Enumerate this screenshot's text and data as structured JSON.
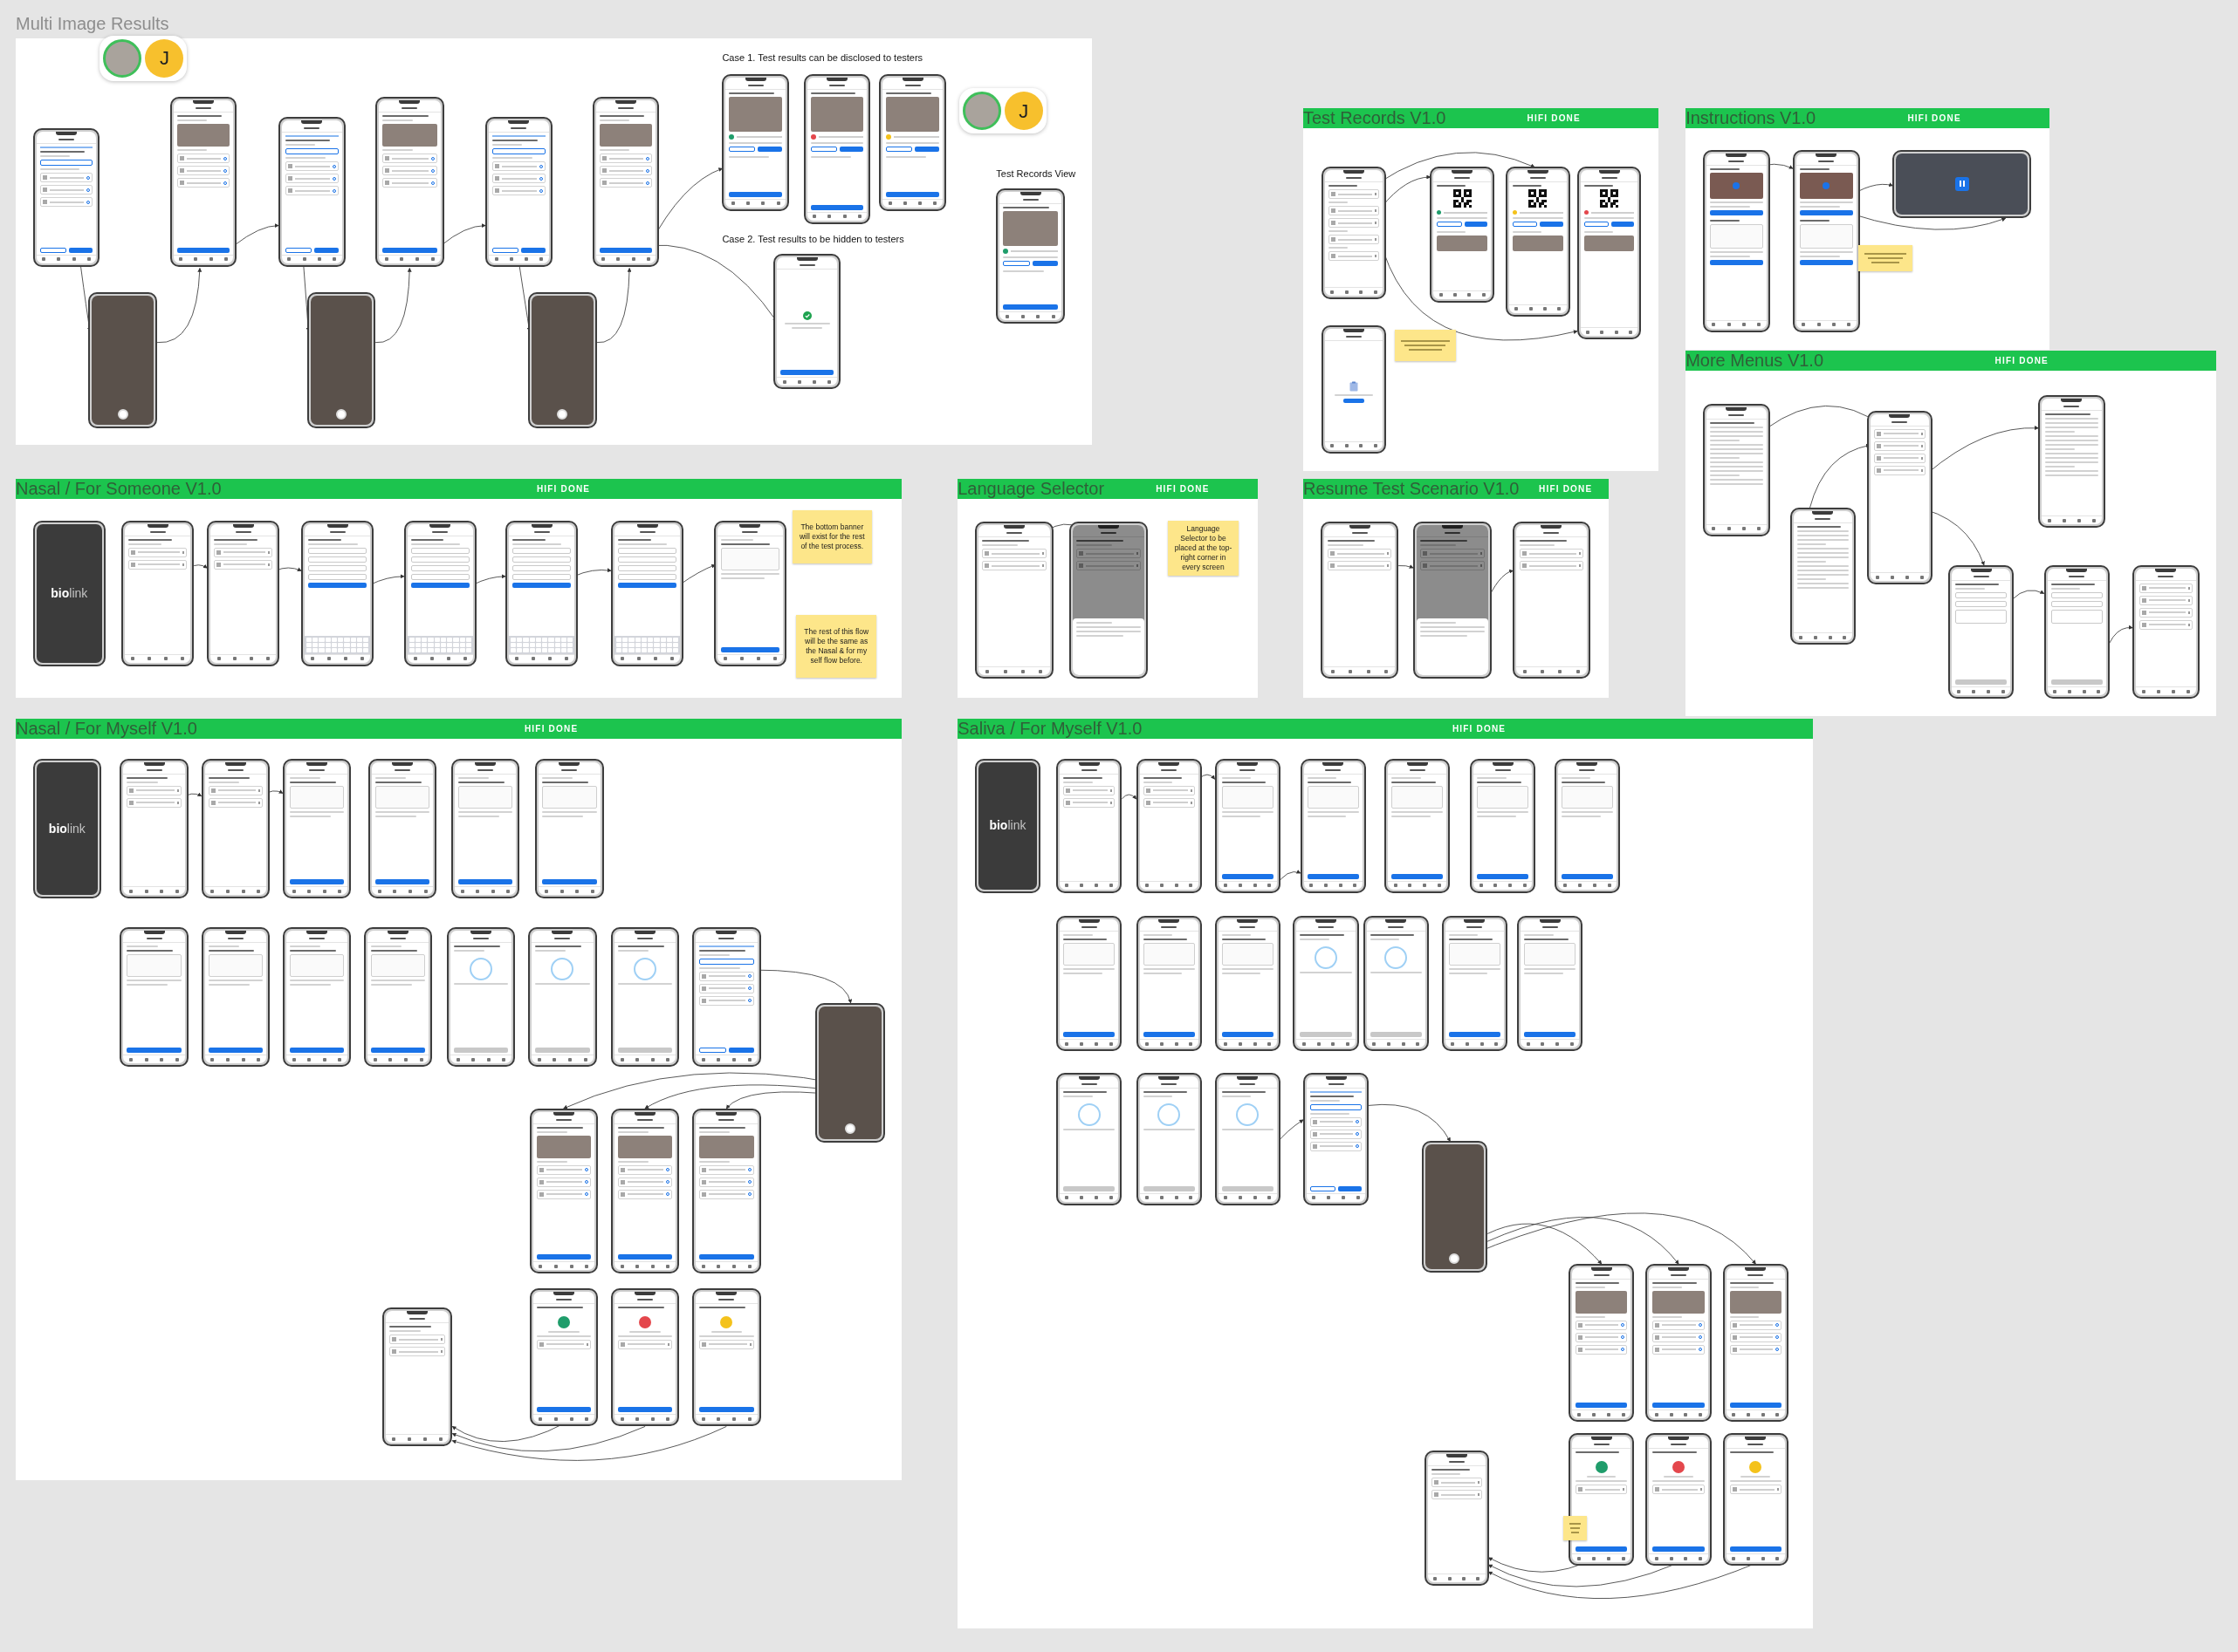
{
  "canvas": {
    "frames": [
      {
        "title": "Multi Image Results",
        "avatar_groups": [
          {
            "initial": "J"
          },
          {
            "initial": "J"
          }
        ],
        "captions": [
          {
            "text": "Case 1. Test results can be disclosed to testers"
          },
          {
            "text": "Case 2. Test results to be hidden to testers"
          },
          {
            "text": "Test Records View"
          }
        ],
        "screens": [
          {
            "kind": "choice"
          },
          {
            "kind": "photo"
          },
          {
            "kind": "choice"
          },
          {
            "kind": "photo"
          },
          {
            "kind": "choice"
          },
          {
            "kind": "photo"
          },
          {
            "kind": "camera"
          },
          {
            "kind": "camera"
          },
          {
            "kind": "camera"
          },
          {
            "kind": "record",
            "color": "#1f9d6b"
          },
          {
            "kind": "record",
            "color": "#e4474c"
          },
          {
            "kind": "record",
            "color": "#f4c21b"
          },
          {
            "kind": "done"
          },
          {
            "kind": "record",
            "color": "#1f9d6b"
          }
        ]
      },
      {
        "title": "Test Records V1.0",
        "badge": "HIFI DONE",
        "screens": [
          {
            "kind": "records"
          },
          {
            "kind": "qr",
            "color": "#1f9d6b"
          },
          {
            "kind": "qr",
            "color": "#f4c21b"
          },
          {
            "kind": "qr",
            "color": "#e4474c"
          },
          {
            "kind": "empty"
          }
        ],
        "notes": [
          {
            "kind": "scribble"
          }
        ]
      },
      {
        "title": "Instructions V1.0",
        "badge": "HIFI DONE",
        "screens": [
          {
            "kind": "instructions"
          },
          {
            "kind": "instructions"
          },
          {
            "kind": "video"
          }
        ],
        "notes": [
          {
            "kind": "scribble"
          }
        ]
      },
      {
        "title": "More Menus V1.0",
        "badge": "HIFI DONE",
        "screens": [
          {
            "kind": "text"
          },
          {
            "kind": "text"
          },
          {
            "kind": "menu"
          },
          {
            "kind": "text"
          },
          {
            "kind": "form"
          },
          {
            "kind": "form"
          },
          {
            "kind": "menu"
          }
        ]
      },
      {
        "title": "Nasal / For Someone V1.0",
        "badge": "HIFI DONE",
        "screens": [
          {
            "kind": "splash",
            "logo": "**bio**link"
          },
          {
            "kind": "list"
          },
          {
            "kind": "list"
          },
          {
            "kind": "keyboard"
          },
          {
            "kind": "keyboard"
          },
          {
            "kind": "keyboard"
          },
          {
            "kind": "keyboard"
          },
          {
            "kind": "app"
          }
        ],
        "notes": [
          {
            "kind": "text",
            "text": "The bottom banner will exist for the rest of the test process."
          },
          {
            "kind": "text",
            "text": "The rest of this flow will be the same as the Nasal & for my self flow before."
          }
        ]
      },
      {
        "title": "Language Selector",
        "badge": "HIFI DONE",
        "screens": [
          {
            "kind": "list"
          },
          {
            "kind": "overlay"
          }
        ],
        "notes": [
          {
            "kind": "text",
            "text": "Language Selector to be placed at the top-right corner in every screen"
          }
        ]
      },
      {
        "title": "Resume Test Scenario V1.0",
        "badge": "HIFI DONE",
        "screens": [
          {
            "kind": "list"
          },
          {
            "kind": "overlay"
          },
          {
            "kind": "list"
          }
        ]
      },
      {
        "title": "Nasal / For Myself V1.0",
        "badge": "HIFI DONE",
        "screens": [
          {
            "kind": "splash",
            "logo": "**bio**link"
          },
          {
            "kind": "list"
          },
          {
            "kind": "list"
          },
          {
            "kind": "app"
          },
          {
            "kind": "app"
          },
          {
            "kind": "app"
          },
          {
            "kind": "app"
          },
          {
            "kind": "app"
          },
          {
            "kind": "app"
          },
          {
            "kind": "app"
          },
          {
            "kind": "app"
          },
          {
            "kind": "timer"
          },
          {
            "kind": "timer"
          },
          {
            "kind": "timer"
          },
          {
            "kind": "choice"
          },
          {
            "kind": "camera"
          },
          {
            "kind": "photo"
          },
          {
            "kind": "photo"
          },
          {
            "kind": "photo"
          },
          {
            "kind": "result",
            "color": "#1f9d6b"
          },
          {
            "kind": "result",
            "color": "#e4474c"
          },
          {
            "kind": "result",
            "color": "#f4c21b"
          },
          {
            "kind": "list"
          }
        ]
      },
      {
        "title": "Saliva / For Myself V1.0",
        "badge": "HIFI DONE",
        "screens": [
          {
            "kind": "splash",
            "logo": "**bio**link"
          },
          {
            "kind": "list"
          },
          {
            "kind": "list"
          },
          {
            "kind": "app"
          },
          {
            "kind": "app"
          },
          {
            "kind": "app"
          },
          {
            "kind": "app"
          },
          {
            "kind": "app"
          },
          {
            "kind": "app"
          },
          {
            "kind": "app"
          },
          {
            "kind": "app"
          },
          {
            "kind": "timer"
          },
          {
            "kind": "timer"
          },
          {
            "kind": "app"
          },
          {
            "kind": "app"
          },
          {
            "kind": "timer"
          },
          {
            "kind": "timer"
          },
          {
            "kind": "timer"
          },
          {
            "kind": "choice"
          },
          {
            "kind": "camera"
          },
          {
            "kind": "photo"
          },
          {
            "kind": "photo"
          },
          {
            "kind": "photo"
          },
          {
            "kind": "result",
            "color": "#1f9d6b"
          },
          {
            "kind": "result",
            "color": "#e4474c"
          },
          {
            "kind": "result",
            "color": "#f4c21b"
          },
          {
            "kind": "list"
          }
        ],
        "notes": [
          {
            "kind": "scribble"
          }
        ]
      }
    ]
  }
}
